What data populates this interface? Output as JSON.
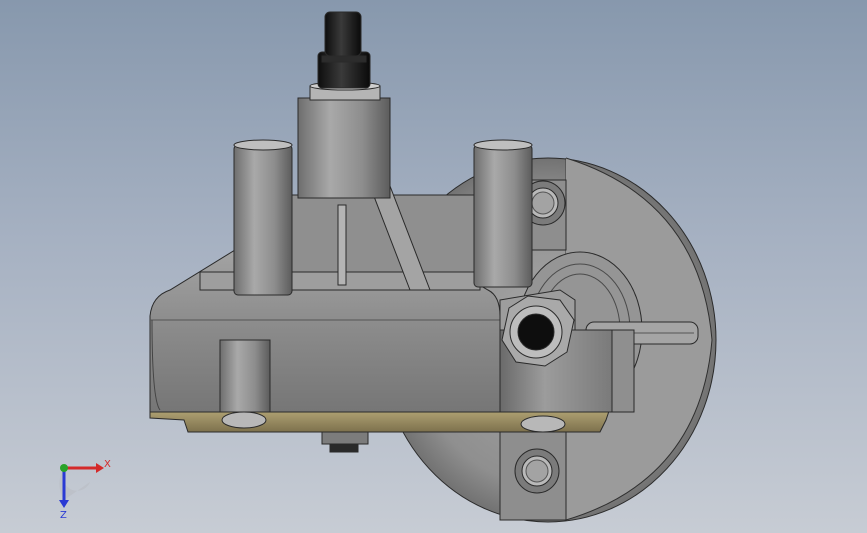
{
  "viewport": {
    "background_top": "#8798ad",
    "background_bottom": "#c7ccd4"
  },
  "triad": {
    "x_label": "X",
    "z_label": "Z",
    "x_color": "#d42a2a",
    "y_color": "#29a329",
    "z_color": "#2a3ad4"
  },
  "model": {
    "housing_color": "#8c8c8c",
    "flange_color": "#9a9a9a",
    "gasket_color": "#a89a6a",
    "connector_color": "#1c1c1c",
    "icons": [
      "wiper-motor-model",
      "coordinate-triad-icon"
    ]
  }
}
